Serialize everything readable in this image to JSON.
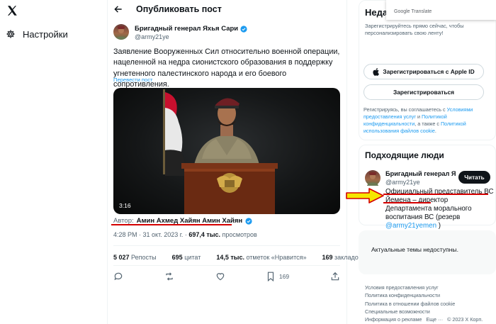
{
  "nav": {
    "settings_label": "Настройки"
  },
  "header": {
    "title": "Опубликовать пост"
  },
  "tweet": {
    "author_name": "Бригадный генерал Яхья Сари",
    "author_handle": "@army21ye",
    "text": "Заявление Вооруженных Сил относительно военной операции, нацеленной на недра сионистского образования в поддержку угнетенного палестинского народа и его боевого сопротивления.",
    "translate_label": "Перевести пост",
    "video_duration": "3:16",
    "credit_prefix": "Автор:",
    "credit_name": "Амин Ахмед Хайян Амин Хайян",
    "time": "4:28 PM · 31 окт. 2023 г. · ",
    "views_count": "697,4 тыс.",
    "views_label": " просмотров",
    "stats": {
      "reposts_count": "5 027",
      "reposts_label": "Репосты",
      "quotes_count": "695",
      "quotes_label": "цитат",
      "likes_count": "14,5 тыс.",
      "likes_label": "отметок «Нравится»",
      "bookmarks_count": "169",
      "bookmarks_label": "закладок"
    },
    "bookmark_action_count": "169"
  },
  "signup": {
    "title": "Неда",
    "subtitle": "Зарегистрируйтесь прямо сейчас, чтобы персонализировать свою ленту!",
    "apple_button": "Зарегистрироваться с Apple ID",
    "register_button": "Зарегистрироваться",
    "terms_prefix": "Регистрируясь, вы соглашаетесь с ",
    "terms_link1": "Условиями предоставления услуг",
    "terms_and": " и ",
    "terms_link2": "Политикой конфиденциальности",
    "terms_also": ", а также с ",
    "terms_link3": "Политикой использования файлов cookie",
    "terms_end": "."
  },
  "google_translate": {
    "label": "Google Translate"
  },
  "people": {
    "title": "Подходящие люди",
    "name": "Бригадный генерал Я",
    "handle": "@army21ye",
    "follow_label": "Читать",
    "bio_text": "Официальный представитель ВС Йемена – директор Департамента морального воспитания ВС (резерв ",
    "bio_link": "@army21yemen",
    "bio_end": " )"
  },
  "trends": {
    "text": "Актуальные темы недоступны."
  },
  "footer": {
    "links": [
      "Условия предоставления услуг",
      "Политика конфиденциальности",
      "Политика в отношении файлов cookie",
      "Специальные возможности",
      "Информация о рекламе   Еще ···   © 2023 X Корп."
    ]
  },
  "colors": {
    "accent": "#1d9bf0",
    "annotation_red": "#d40000",
    "annotation_yellow": "#f5e600"
  }
}
